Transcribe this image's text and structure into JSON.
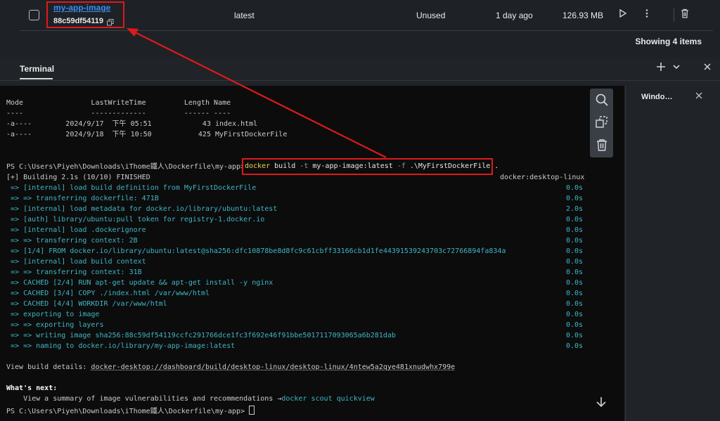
{
  "image_row": {
    "name": "my-app-image",
    "id": "88c59df54119",
    "tag": "latest",
    "status": "Unused",
    "created": "1 day ago",
    "size": "126.93 MB"
  },
  "showing_text": "Showing 4 items",
  "terminal": {
    "tab_label": "Terminal",
    "side_title": "Windo…",
    "listing": {
      "headers": [
        "Mode",
        "LastWriteTime",
        "Length",
        "Name"
      ],
      "underline": [
        "----",
        "-------------",
        "------",
        "----"
      ],
      "rows": [
        {
          "mode": "-a----",
          "date": "2024/9/17",
          "ampm": "下午",
          "time": "05:51",
          "length": "43",
          "name": "index.html"
        },
        {
          "mode": "-a----",
          "date": "2024/9/18",
          "ampm": "下午",
          "time": "10:50",
          "length": "425",
          "name": "MyFirstDockerFile"
        }
      ]
    },
    "prompt": "PS C:\\Users\\Piyeh\\Downloads\\iThome鐵人\\Dockerfile\\my-app>",
    "command": {
      "docker": "docker",
      "build": "build",
      "flag_t": "-t",
      "image": "my-app-image:latest",
      "flag_f": "-f",
      "file": ".\\MyFirstDockerFile",
      "context": "."
    },
    "building": "[+] Building 2.1s (10/10) FINISHED",
    "builder": "docker:desktop-linux",
    "steps": [
      {
        "text": " => [internal] load build definition from MyFirstDockerFile",
        "time": "0.0s"
      },
      {
        "text": " => => transferring dockerfile: 471B",
        "time": "0.0s"
      },
      {
        "text": " => [internal] load metadata for docker.io/library/ubuntu:latest",
        "time": "2.0s"
      },
      {
        "text": " => [auth] library/ubuntu:pull token for registry-1.docker.io",
        "time": "0.0s"
      },
      {
        "text": " => [internal] load .dockerignore",
        "time": "0.0s"
      },
      {
        "text": " => => transferring context: 2B",
        "time": "0.0s"
      },
      {
        "text": " => [1/4] FROM docker.io/library/ubuntu:latest@sha256:dfc10878be8d8fc9c61cbff33166cb1d1fe44391539243703c72766894fa834a",
        "time": "0.0s"
      },
      {
        "text": " => [internal] load build context",
        "time": "0.0s"
      },
      {
        "text": " => => transferring context: 31B",
        "time": "0.0s"
      },
      {
        "text": " => CACHED [2/4] RUN apt-get update && apt-get install -y nginx",
        "time": "0.0s"
      },
      {
        "text": " => CACHED [3/4] COPY ./index.html /var/www/html",
        "time": "0.0s"
      },
      {
        "text": " => CACHED [4/4] WORKDIR /var/www/html",
        "time": "0.0s"
      },
      {
        "text": " => exporting to image",
        "time": "0.0s"
      },
      {
        "text": " => => exporting layers",
        "time": "0.0s"
      },
      {
        "text": " => => writing image sha256:88c59df54119ccfc291766dce1fc3f692e46f91bbe5017117093065a6b281dab",
        "time": "0.0s"
      },
      {
        "text": " => => naming to docker.io/library/my-app-image:latest",
        "time": "0.0s"
      }
    ],
    "view_details_label": "View build details: ",
    "view_details_link": "docker-desktop://dashboard/build/desktop-linux/desktop-linux/4ntew5a2qye481xnudwhx799e",
    "whats_next": "What's next:",
    "summary_text": "    View a summary of image vulnerabilities and recommendations →",
    "scout_cmd": "docker scout quickview",
    "final_prompt": "PS C:\\Users\\Piyeh\\Downloads\\iThome鐵人\\Dockerfile\\my-app>"
  },
  "colors": {
    "accent_link": "#3b8cf0",
    "annotation_red": "#e0191a",
    "terminal_cyan": "#3fb6c4",
    "command_yellow": "#f0d050"
  }
}
